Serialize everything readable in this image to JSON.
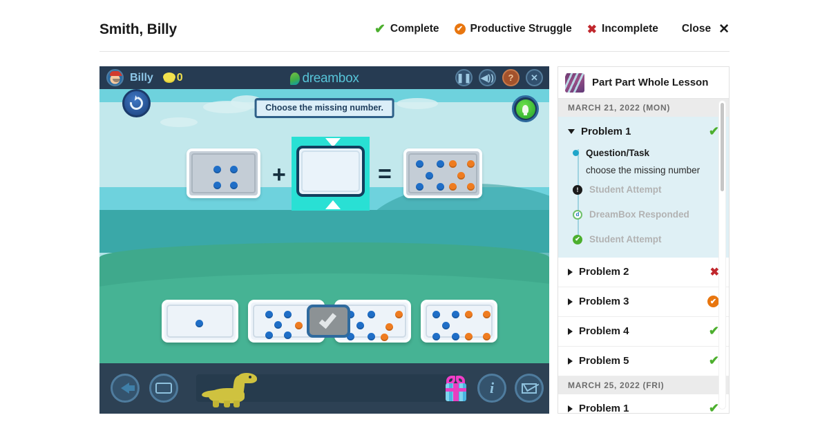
{
  "header": {
    "student_name": "Smith, Billy",
    "legend": [
      {
        "label": "Complete",
        "icon": "green-check-icon",
        "color": "#4caf2e"
      },
      {
        "label": "Productive Struggle",
        "icon": "orange-circle-check-icon",
        "color": "#e8760f"
      },
      {
        "label": "Incomplete",
        "icon": "red-x-icon",
        "color": "#c0272d"
      }
    ],
    "close_label": "Close",
    "close_icon": "close-x-icon"
  },
  "game": {
    "topbar": {
      "player_name": "Billy",
      "coin_count": "0",
      "brand": "dreambox",
      "buttons": [
        {
          "name": "pause-button",
          "glyph": "❚❚"
        },
        {
          "name": "sound-button",
          "glyph": "🔊"
        },
        {
          "name": "help-button",
          "glyph": "?"
        },
        {
          "name": "close-game-button",
          "glyph": "✕"
        }
      ]
    },
    "prompt": "Choose the missing number.",
    "hint_icon": "lightbulb-hint-icon",
    "reset_icon": "reset-arrow-icon",
    "equation": {
      "plus": "+",
      "equals": "=",
      "addend_one_blue_dots": 4,
      "addend_one_orange_dots": 0,
      "missing_value": "",
      "result_blue_dots": 5,
      "result_orange_dots": 5
    },
    "choices": [
      {
        "name": "answer-choice-1",
        "blue_dots": 1,
        "orange_dots": 0,
        "total": 1
      },
      {
        "name": "answer-choice-2",
        "blue_dots": 5,
        "orange_dots": 1,
        "total": 6
      },
      {
        "name": "answer-choice-3",
        "blue_dots": 5,
        "orange_dots": 3,
        "total": 8
      },
      {
        "name": "answer-choice-4",
        "blue_dots": 5,
        "orange_dots": 4,
        "total": 9
      }
    ],
    "submit_icon": "check-submit-icon",
    "bottombar": {
      "back_icon": "back-arrow-icon",
      "keyboard_icon": "keyboard-icon",
      "mascot_icon": "dinosaur-mascot-icon",
      "gift_icon": "gift-box-icon",
      "info_icon": "info-icon",
      "mail_icon": "mail-icon"
    }
  },
  "sidebar": {
    "lesson_title": "Part Part Whole Lesson",
    "lesson_thumb_icon": "lesson-thumbnail-icon",
    "groups": [
      {
        "date": "MARCH 21, 2022 (MON)",
        "problems": [
          {
            "label": "Problem 1",
            "status": "complete",
            "expanded": true
          },
          {
            "label": "Problem 2",
            "status": "incomplete",
            "expanded": false
          },
          {
            "label": "Problem 3",
            "status": "struggle",
            "expanded": false
          },
          {
            "label": "Problem 4",
            "status": "complete",
            "expanded": false
          },
          {
            "label": "Problem 5",
            "status": "complete",
            "expanded": false
          }
        ]
      },
      {
        "date": "MARCH 25, 2022 (FRI)",
        "problems": [
          {
            "label": "Problem 1",
            "status": "complete",
            "expanded": false
          }
        ]
      }
    ],
    "timeline": [
      {
        "label": "Question/Task",
        "marker": "blue-dot",
        "muted": false
      },
      {
        "label": "Student Attempt",
        "marker": "dark-badge",
        "muted": true
      },
      {
        "label": "DreamBox Responded",
        "marker": "dreambox-badge",
        "muted": true
      },
      {
        "label": "Student Attempt",
        "marker": "green-badge",
        "muted": true
      }
    ],
    "timeline_detail": "choose the missing number"
  }
}
